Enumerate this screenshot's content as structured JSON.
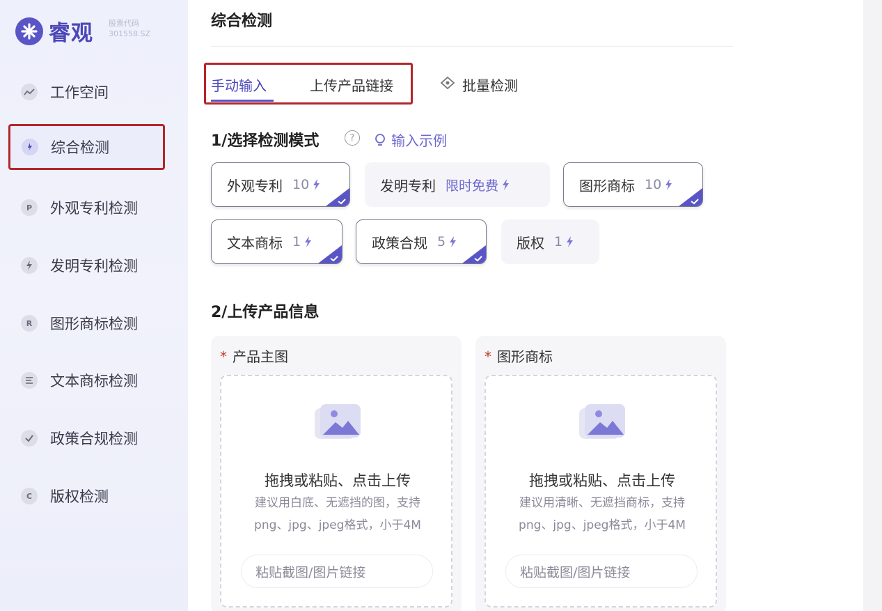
{
  "brand": {
    "name": "睿观",
    "stock_label": "股票代码",
    "stock_code": "301558.SZ"
  },
  "sidebar": {
    "items": [
      {
        "label": "工作空间",
        "icon": "chart-icon"
      },
      {
        "label": "综合检测",
        "icon": "search-bolt-icon"
      },
      {
        "label": "外观专利检测",
        "icon": "p-badge-icon"
      },
      {
        "label": "发明专利检测",
        "icon": "bolt-badge-icon"
      },
      {
        "label": "图形商标检测",
        "icon": "r-badge-icon"
      },
      {
        "label": "文本商标检测",
        "icon": "text-lines-icon"
      },
      {
        "label": "政策合规检测",
        "icon": "shield-check-icon"
      },
      {
        "label": "版权检测",
        "icon": "c-badge-icon"
      }
    ],
    "active_index": 1
  },
  "main": {
    "title": "综合检测",
    "tabs": [
      {
        "label": "手动输入",
        "active": true
      },
      {
        "label": "上传产品链接",
        "active": false
      },
      {
        "label": "批量检测",
        "active": false,
        "icon": "diamond-icon"
      }
    ],
    "step1": {
      "title": "1/选择检测模式",
      "help_icon": "question-icon",
      "example_link": "输入示例",
      "modes": [
        {
          "name": "外观专利",
          "cost": "10",
          "selected": true
        },
        {
          "name": "发明专利",
          "cost": "限时免费",
          "selected": false
        },
        {
          "name": "图形商标",
          "cost": "10",
          "selected": true
        },
        {
          "name": "文本商标",
          "cost": "1",
          "selected": true
        },
        {
          "name": "政策合规",
          "cost": "5",
          "selected": true
        },
        {
          "name": "版权",
          "cost": "1",
          "selected": false
        }
      ]
    },
    "step2": {
      "title": "2/上传产品信息",
      "uploads": [
        {
          "label": "产品主图",
          "required": "*",
          "drop_title": "拖拽或粘贴、点击上传",
          "hint_line1": "建议用白底、无遮挡的图，支持",
          "hint_line2": "png、jpg、jpeg格式，小于4M",
          "input_placeholder": "粘贴截图/图片链接"
        },
        {
          "label": "图形商标",
          "required": "*",
          "drop_title": "拖拽或粘贴、点击上传",
          "hint_line1": "建议用清晰、无遮挡商标，支持",
          "hint_line2": "png、jpg、jpeg格式，小于4M",
          "input_placeholder": "粘贴截图/图片链接"
        }
      ]
    }
  },
  "colors": {
    "accent": "#5a55c7",
    "highlight_box": "#b3262c",
    "required": "#c0392b"
  }
}
